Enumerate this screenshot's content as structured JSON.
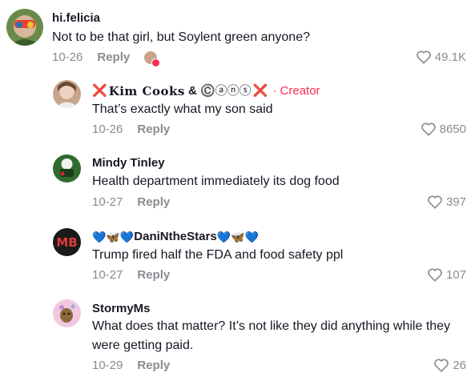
{
  "comments": [
    {
      "username": "hi.felicia",
      "text": "Not to be that girl, but Soylent green anyone?",
      "date": "10-26",
      "reply_label": "Reply",
      "likes": "49.1K"
    },
    {
      "username_prefix": "❌",
      "username": "Kim Cooks",
      "username_mid": " & ",
      "username_suffix": "©️ⓐⓝⓢ",
      "username_end": "❌",
      "creator_label": "· Creator",
      "text": "That’s exactly what my son said",
      "date": "10-26",
      "reply_label": "Reply",
      "likes": "8650"
    },
    {
      "username": "Mindy Tinley",
      "text": "Health department immediately its dog food",
      "date": "10-27",
      "reply_label": "Reply",
      "likes": "397"
    },
    {
      "avatar_text": "MB",
      "username_prefix": "💙🦋💙",
      "username": "DaniNtheStars",
      "username_suffix": "💙🦋💙",
      "text": "Trump fired half the FDA and food safety ppl",
      "date": "10-27",
      "reply_label": "Reply",
      "likes": "107"
    },
    {
      "username": "StormyMs",
      "text": "What does that matter? It’s not like they did anything while they were getting paid.",
      "date": "10-29",
      "reply_label": "Reply",
      "likes": "26"
    }
  ],
  "colors": {
    "text": "#161823",
    "muted": "#8a8b91",
    "creator": "#fe2c55"
  },
  "icons": [
    "heart-outline-icon",
    "mini-avatar-icon"
  ]
}
